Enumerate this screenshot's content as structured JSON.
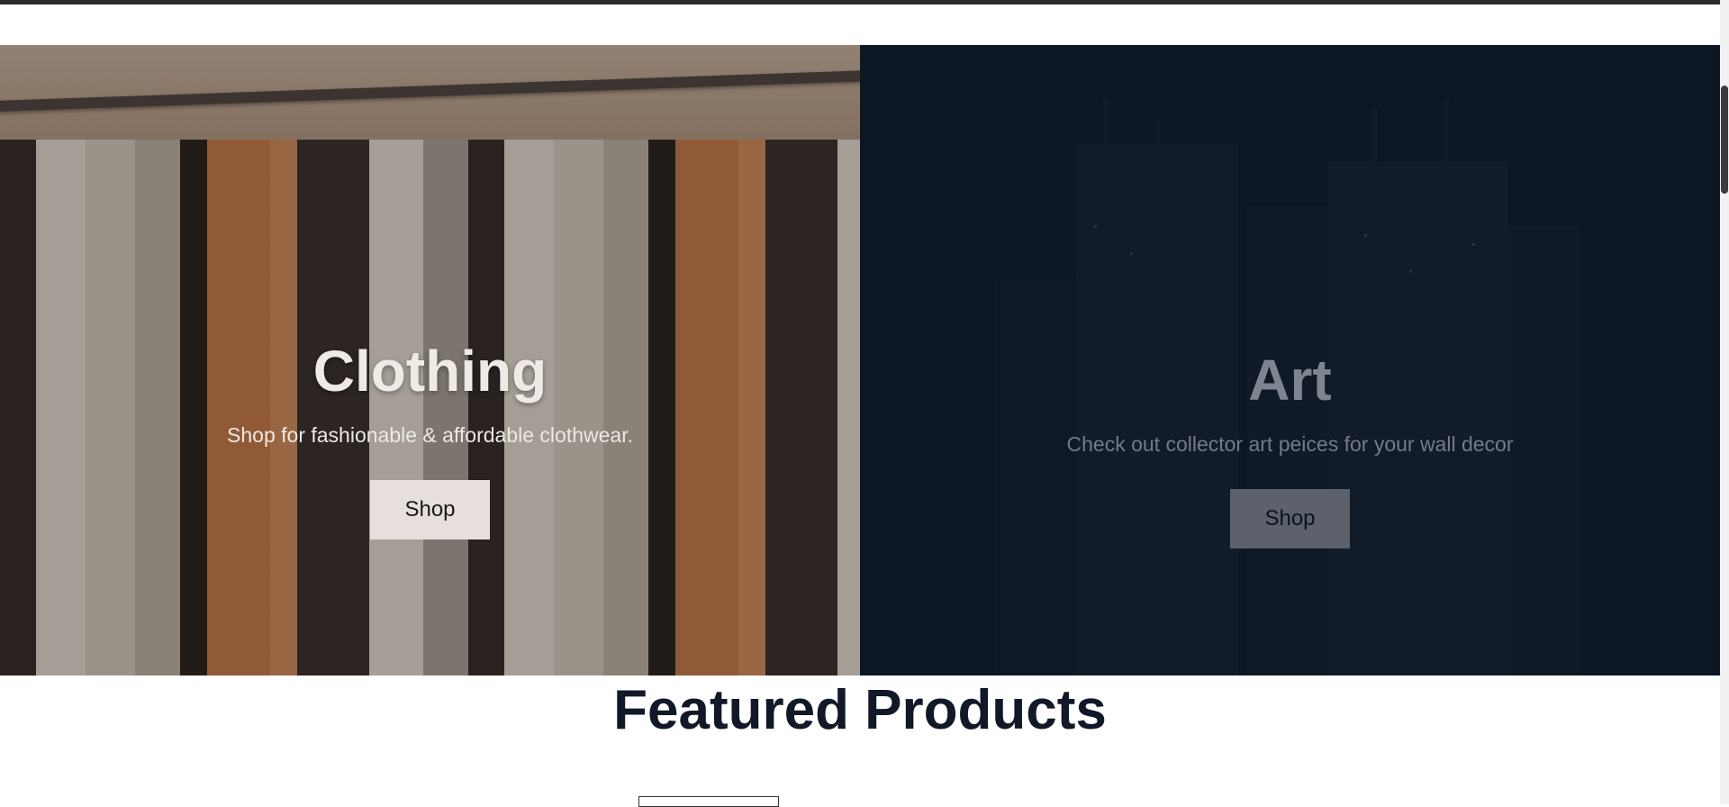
{
  "hero": {
    "clothing": {
      "title": "Clothing",
      "description": "Shop for fashionable & affordable clothwear.",
      "button_label": "Shop"
    },
    "art": {
      "title": "Art",
      "description": "Check out collector art peices for your wall decor",
      "button_label": "Shop"
    }
  },
  "featured": {
    "title": "Featured Products"
  },
  "colors": {
    "heading": "#111827",
    "art_panel_bg": "#0d1724",
    "topbar": "#2b2b2b"
  }
}
